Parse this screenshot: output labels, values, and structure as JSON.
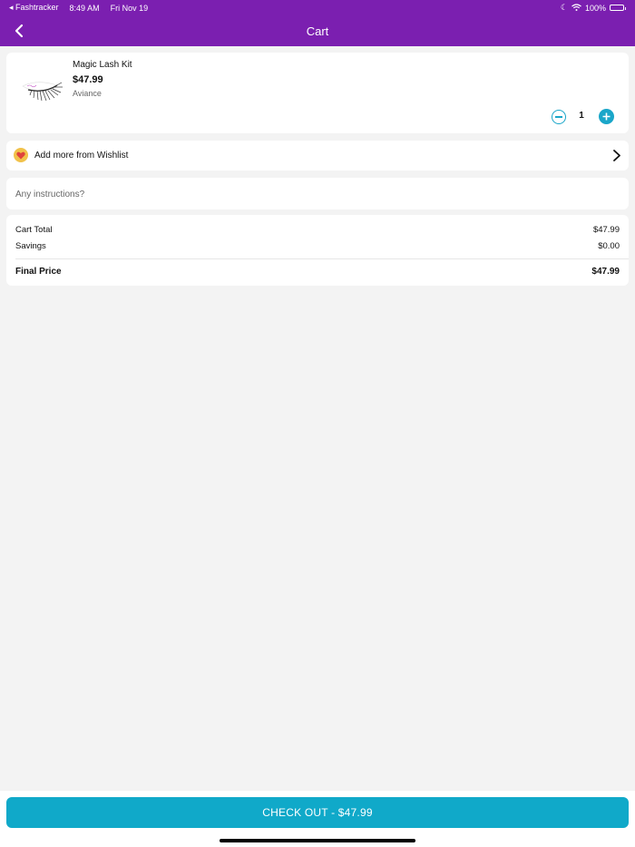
{
  "status_bar": {
    "back_app": "◂ Fashtracker",
    "time": "8:49 AM",
    "date": "Fri Nov 19",
    "battery": "100%"
  },
  "nav": {
    "title": "Cart"
  },
  "cart_item": {
    "name": "Magic Lash Kit",
    "price": "$47.99",
    "brand": "Aviance",
    "quantity": "1"
  },
  "wishlist": {
    "label": "Add more from Wishlist"
  },
  "instructions": {
    "placeholder": "Any instructions?"
  },
  "summary": {
    "cart_total_label": "Cart Total",
    "cart_total_value": "$47.99",
    "savings_label": "Savings",
    "savings_value": "$0.00",
    "final_label": "Final Price",
    "final_value": "$47.99"
  },
  "checkout": {
    "label": "CHECK OUT - $47.99"
  },
  "colors": {
    "header": "#7b1fb0",
    "accent": "#10a9c9",
    "badge": "#f1c24a",
    "heart": "#e0433d"
  }
}
